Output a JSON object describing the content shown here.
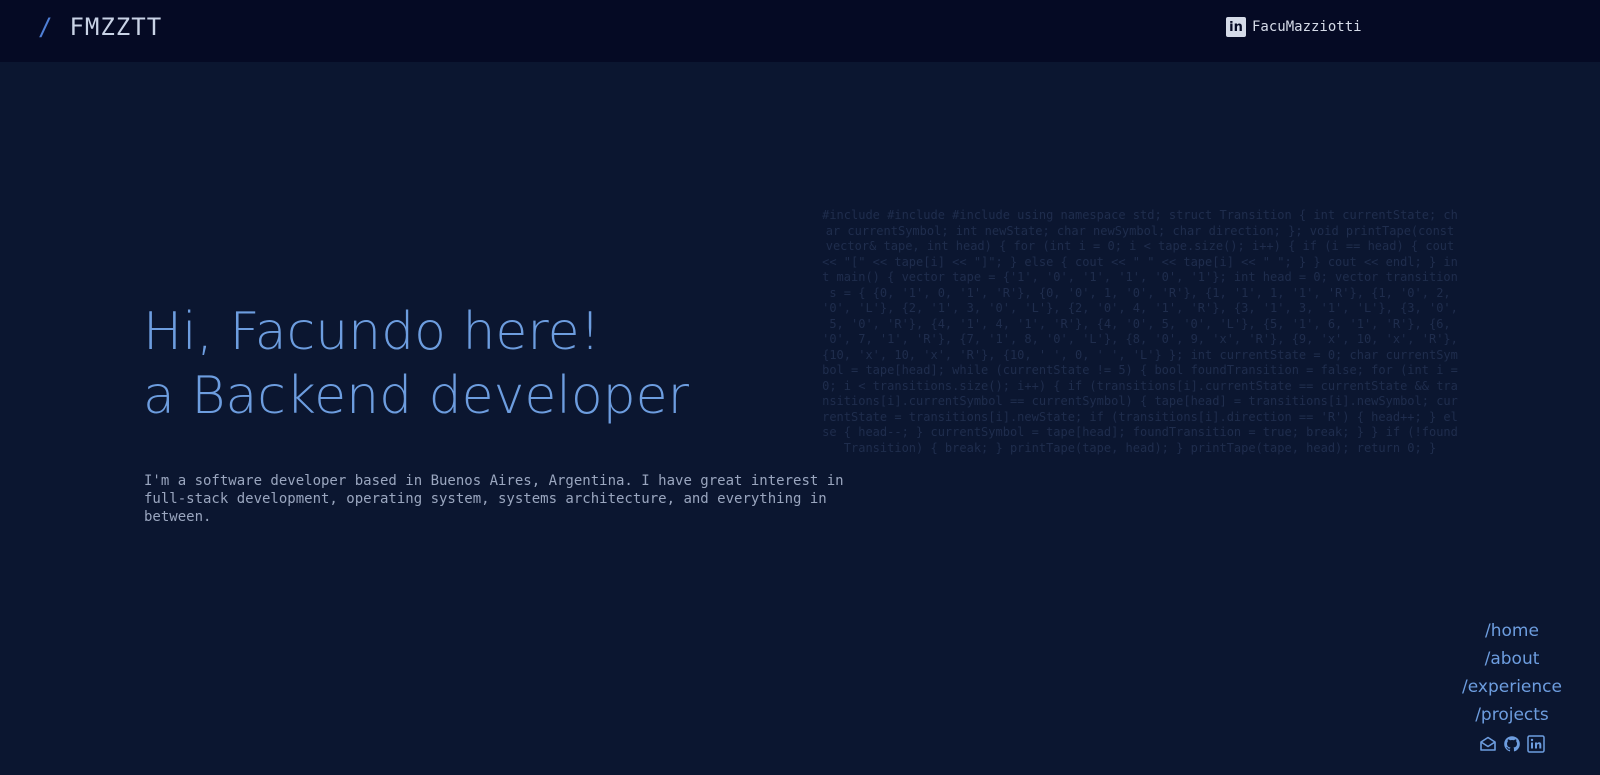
{
  "header": {
    "brand_slash": "/",
    "brand_name": "FMZZTT",
    "profile_icon": "linkedin-icon",
    "profile_glyph": "in",
    "profile_label": "FacuMazziotti"
  },
  "hero": {
    "line1": "Hi, Facundo here!",
    "line2": "a Backend developer",
    "intro": "I'm a software developer based in Buenos Aires, Argentina. I have great interest in full-stack development, operating system, systems architecture, and everything in between."
  },
  "background_code": "#include #include #include using namespace std; struct Transition { int currentState; char currentSymbol; int newState; char newSymbol; char direction; }; void printTape(const vector& tape, int head) { for (int i = 0; i < tape.size(); i++) { if (i == head) { cout << \"[\" << tape[i] << \"]\"; } else { cout << \" \" << tape[i] << \" \"; } } cout << endl; } int main() { vector tape = {'1', '0', '1', '1', '0', '1'}; int head = 0; vector transitions = { {0, '1', 0, '1', 'R'}, {0, '0', 1, '0', 'R'}, {1, '1', 1, '1', 'R'}, {1, '0', 2, '0', 'L'}, {2, '1', 3, '0', 'L'}, {2, '0', 4, '1', 'R'}, {3, '1', 3, '1', 'L'}, {3, '0', 5, '0', 'R'}, {4, '1', 4, '1', 'R'}, {4, '0', 5, '0', 'L'}, {5, '1', 6, '1', 'R'}, {6, '0', 7, '1', 'R'}, {7, '1', 8, '0', 'L'}, {8, '0', 9, 'x', 'R'}, {9, 'x', 10, 'x', 'R'}, {10, 'x', 10, 'x', 'R'}, {10, ' ', 0, ' ', 'L'} }; int currentState = 0; char currentSymbol = tape[head]; while (currentState != 5) { bool foundTransition = false; for (int i = 0; i < transitions.size(); i++) { if (transitions[i].currentState == currentState && transitions[i].currentSymbol == currentSymbol) { tape[head] = transitions[i].newSymbol; currentState = transitions[i].newState; if (transitions[i].direction == 'R') { head++; } else { head--; } currentSymbol = tape[head]; foundTransition = true; break; } } if (!foundTransition) { break; } printTape(tape, head); } printTape(tape, head); return 0; }",
  "side_nav": {
    "items": [
      {
        "label": "/home"
      },
      {
        "label": "/about"
      },
      {
        "label": "/experience"
      },
      {
        "label": "/projects"
      }
    ],
    "social_icons": [
      "mail-icon",
      "github-icon",
      "linkedin-icon"
    ]
  },
  "colors": {
    "background": "#0b1630",
    "topbar": "#050a24",
    "accent": "#6d9ddf",
    "text_muted": "#9aa6bf"
  }
}
